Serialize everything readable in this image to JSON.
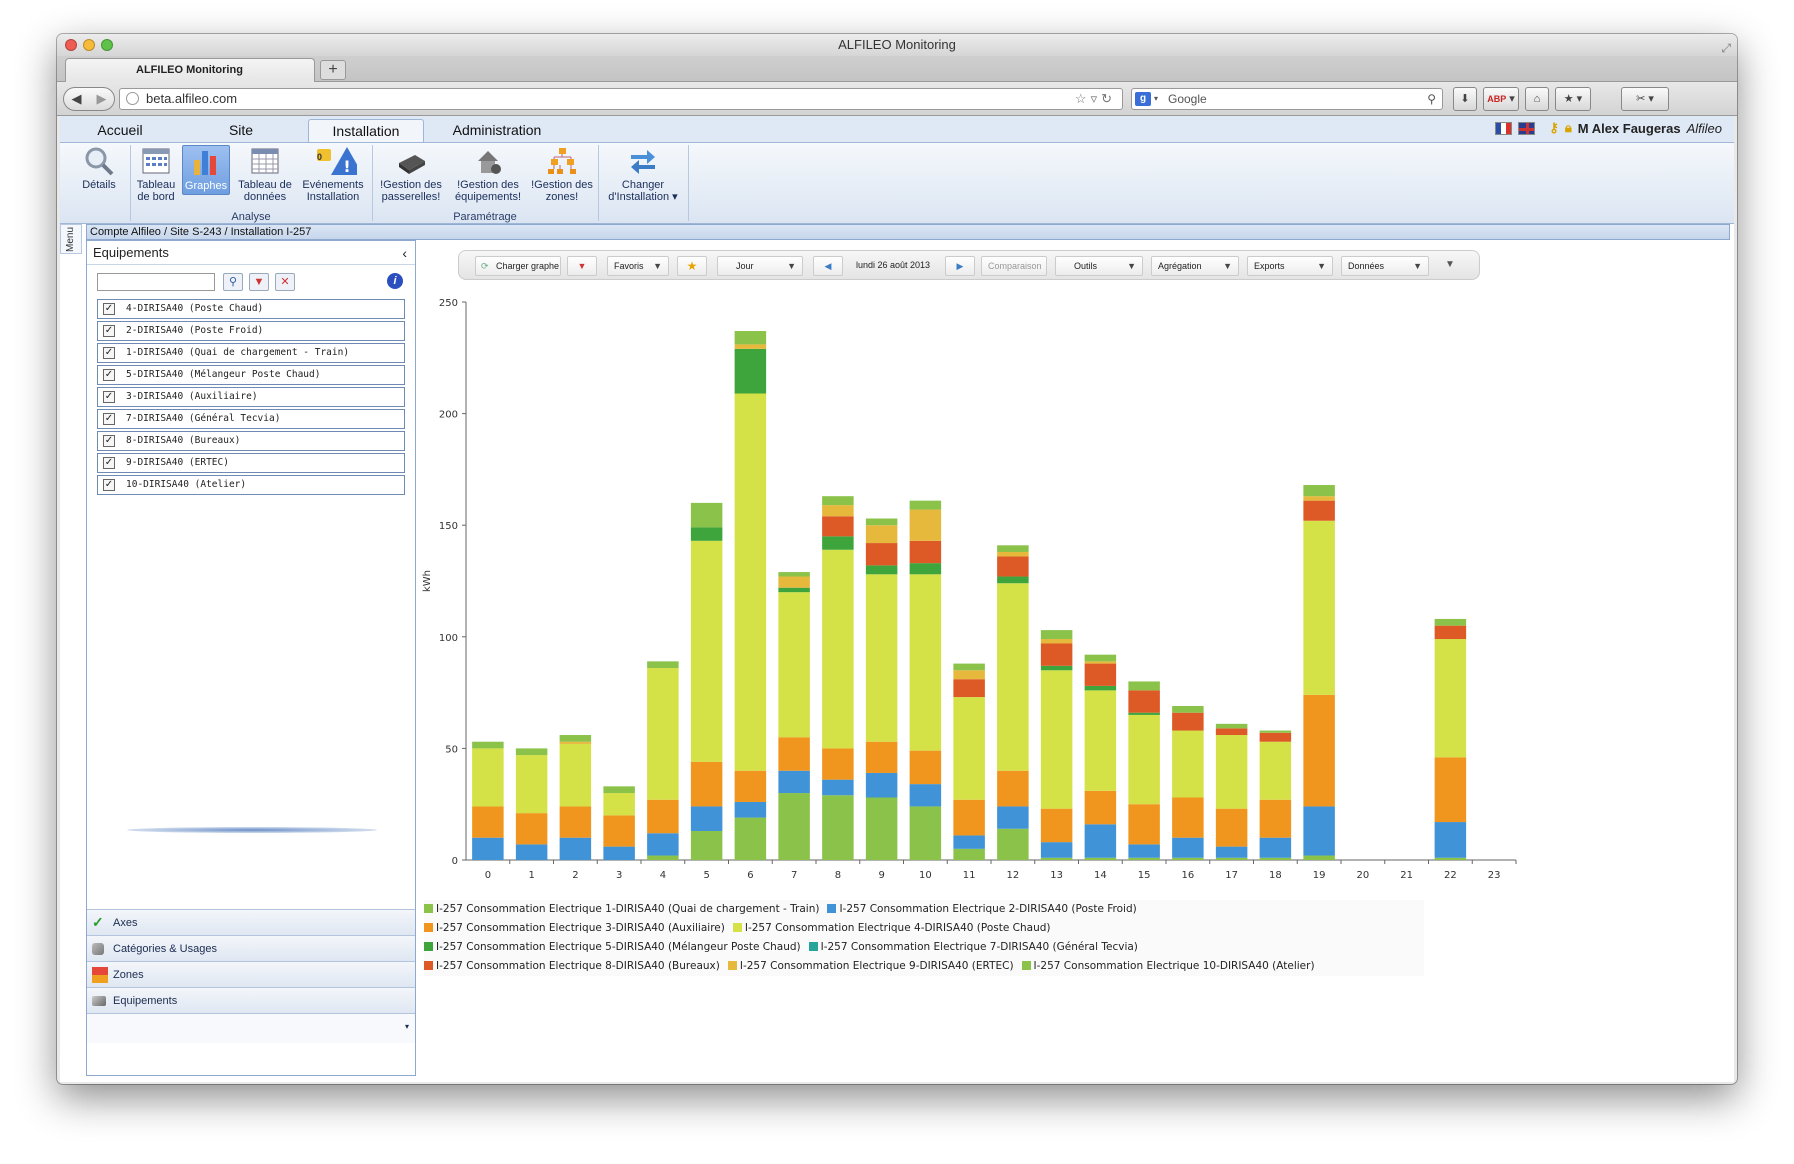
{
  "window": {
    "title": "ALFILEO Monitoring"
  },
  "browser": {
    "tab_title": "ALFILEO Monitoring",
    "new_tab": "+",
    "url_prefix": "beta.",
    "url_host": "alfileo.com",
    "search_engine": "Google",
    "search_placeholder": "Google"
  },
  "app": {
    "tabs": [
      {
        "label": "Accueil"
      },
      {
        "label": "Site"
      },
      {
        "label": "Installation",
        "active": true
      },
      {
        "label": "Administration"
      }
    ],
    "user": {
      "name": "M Alex Faugeras",
      "company": "Alfileo",
      "flags": [
        "fr",
        "en"
      ]
    },
    "ribbon": {
      "buttons": [
        {
          "label": "Détails",
          "icon": "magnifier-icon"
        },
        {
          "label": "Tableau de bord",
          "icon": "dashboard-table-icon"
        },
        {
          "label": "Graphes",
          "icon": "bar-chart-icon",
          "active": true
        },
        {
          "label": "Tableau de données",
          "icon": "data-table-icon"
        },
        {
          "label": "Evénements Installation",
          "icon": "warning-icon",
          "badge": "0"
        },
        {
          "label": "!Gestion des passerelles!",
          "icon": "gateway-icon"
        },
        {
          "label": "!Gestion des équipements!",
          "icon": "equipment-icon"
        },
        {
          "label": "!Gestion des zones!",
          "icon": "zones-icon"
        },
        {
          "label": "Changer d'Installation",
          "icon": "switch-arrows-icon",
          "dropdown": "▾"
        }
      ],
      "groups": [
        {
          "label": "Analyse"
        },
        {
          "label": "Paramétrage"
        }
      ]
    },
    "side_menu_label": "Menu",
    "breadcrumb": "Compte Alfileo / Site S-243 / Installation I-257",
    "left_panel": {
      "title": "Equipements",
      "collapse": "‹",
      "search_value": "",
      "equipment": [
        {
          "label": "4-DIRISA40 (Poste Chaud)",
          "checked": true
        },
        {
          "label": "2-DIRISA40 (Poste Froid)",
          "checked": true
        },
        {
          "label": "1-DIRISA40 (Quai de chargement - Train)",
          "checked": true
        },
        {
          "label": "5-DIRISA40 (Mélangeur Poste Chaud)",
          "checked": true
        },
        {
          "label": "3-DIRISA40 (Auxiliaire)",
          "checked": true
        },
        {
          "label": "7-DIRISA40 (Général Tecvia)",
          "checked": true
        },
        {
          "label": "8-DIRISA40 (Bureaux)",
          "checked": true
        },
        {
          "label": "9-DIRISA40 (ERTEC)",
          "checked": true
        },
        {
          "label": "10-DIRISA40 (Atelier)",
          "checked": true
        }
      ],
      "accordion": [
        {
          "label": "Axes",
          "icon": "check-icon"
        },
        {
          "label": "Catégories & Usages",
          "icon": "plug-icon"
        },
        {
          "label": "Zones",
          "icon": "zones-icon"
        },
        {
          "label": "Equipements",
          "icon": "equipment-icon"
        }
      ]
    },
    "toolbar": {
      "load_graph": "Charger graphe",
      "favorites": "Favoris",
      "period": "Jour",
      "date": "lundi 26 août 2013",
      "comparison": "Comparaison",
      "tools": "Outils",
      "aggregation": "Agrégation",
      "exports": "Exports",
      "data": "Données"
    }
  },
  "chart_data": {
    "type": "bar",
    "stacked": true,
    "ylabel": "kWh",
    "xlabel": "",
    "ylim": [
      0,
      250
    ],
    "yticks": [
      0,
      50,
      100,
      150,
      200,
      250
    ],
    "categories": [
      "0",
      "1",
      "2",
      "3",
      "4",
      "5",
      "6",
      "7",
      "8",
      "9",
      "10",
      "11",
      "12",
      "13",
      "14",
      "15",
      "16",
      "17",
      "18",
      "19",
      "20",
      "21",
      "22",
      "23"
    ],
    "legend_position": "bottom",
    "series": [
      {
        "name": "I-257 Consommation Electrique 1-DIRISA40 (Quai de chargement - Train)",
        "color": "#8bc34a",
        "values": [
          0,
          0,
          0,
          0,
          2,
          13,
          19,
          30,
          29,
          28,
          24,
          5,
          14,
          1,
          1,
          1,
          1,
          1,
          1,
          2,
          0,
          0,
          1,
          0
        ]
      },
      {
        "name": "I-257 Consommation Electrique 2-DIRISA40 (Poste Froid)",
        "color": "#3f93d6",
        "values": [
          10,
          7,
          10,
          6,
          10,
          11,
          7,
          10,
          7,
          11,
          10,
          6,
          10,
          7,
          15,
          6,
          9,
          5,
          9,
          22,
          0,
          0,
          16,
          0
        ]
      },
      {
        "name": "I-257 Consommation Electrique 3-DIRISA40 (Auxiliaire)",
        "color": "#f0961e",
        "values": [
          14,
          14,
          14,
          14,
          15,
          20,
          14,
          15,
          14,
          14,
          15,
          16,
          16,
          15,
          15,
          18,
          18,
          17,
          17,
          50,
          0,
          0,
          29,
          0
        ]
      },
      {
        "name": "I-257 Consommation Electrique 4-DIRISA40 (Poste Chaud)",
        "color": "#d4e147",
        "values": [
          26,
          26,
          28,
          10,
          59,
          99,
          169,
          65,
          89,
          75,
          79,
          46,
          84,
          62,
          45,
          40,
          30,
          33,
          26,
          78,
          0,
          0,
          53,
          0
        ]
      },
      {
        "name": "I-257 Consommation Electrique 5-DIRISA40 (Mélangeur Poste Chaud)",
        "color": "#3ea43c",
        "values": [
          0,
          0,
          0,
          0,
          0,
          6,
          20,
          2,
          6,
          4,
          5,
          0,
          3,
          2,
          2,
          1,
          0,
          0,
          0,
          0,
          0,
          0,
          0,
          0
        ]
      },
      {
        "name": "I-257 Consommation Electrique 7-DIRISA40 (Général Tecvia)",
        "color": "#26a69a",
        "values": [
          0,
          0,
          0,
          0,
          0,
          0,
          0,
          0,
          0,
          0,
          0,
          0,
          0,
          0,
          0,
          0,
          0,
          0,
          0,
          0,
          0,
          0,
          0,
          0
        ]
      },
      {
        "name": "I-257 Consommation Electrique 8-DIRISA40 (Bureaux)",
        "color": "#dd5a27",
        "values": [
          0,
          0,
          0,
          0,
          0,
          0,
          0,
          0,
          9,
          10,
          10,
          8,
          9,
          10,
          10,
          10,
          8,
          3,
          4,
          9,
          0,
          0,
          6,
          0
        ]
      },
      {
        "name": "I-257 Consommation Electrique 9-DIRISA40 (ERTEC)",
        "color": "#e6b83c",
        "values": [
          0,
          0,
          1,
          0,
          0,
          0,
          2,
          5,
          5,
          8,
          14,
          4,
          2,
          2,
          1,
          0,
          0,
          0,
          0,
          2,
          0,
          0,
          0,
          0
        ]
      },
      {
        "name": "I-257 Consommation Electrique 10-DIRISA40 (Atelier)",
        "color": "#8bc34a",
        "values": [
          3,
          3,
          3,
          3,
          3,
          11,
          6,
          2,
          4,
          3,
          4,
          3,
          3,
          4,
          3,
          4,
          3,
          2,
          1,
          5,
          0,
          0,
          3,
          0
        ]
      }
    ]
  }
}
